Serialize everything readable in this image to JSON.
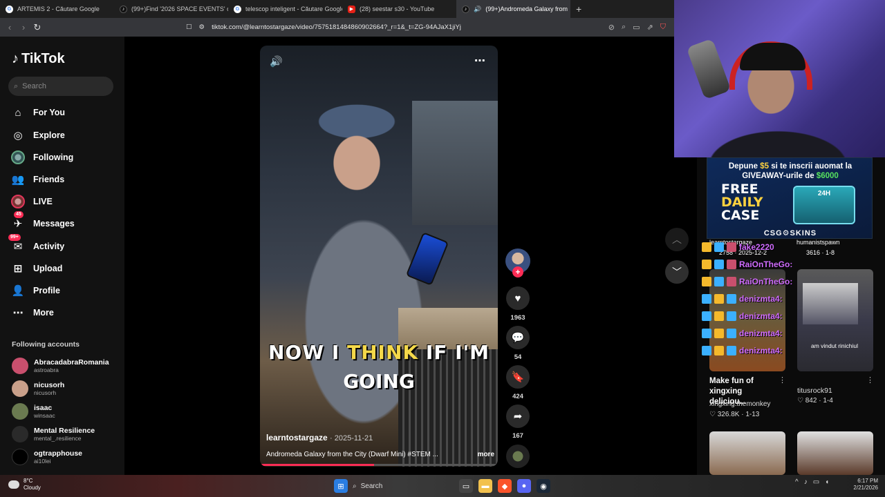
{
  "browser": {
    "tabs": [
      {
        "title": "ARTEMIS 2 - Căutare Google",
        "icon": "google"
      },
      {
        "title": "(99+)Find '2026 SPACE EVENTS' on T",
        "icon": "tiktok"
      },
      {
        "title": "telescop inteligent - Căutare Google",
        "icon": "google"
      },
      {
        "title": "(28) seestar s30 - YouTube",
        "icon": "youtube"
      },
      {
        "title": "(99+)Andromeda Galaxy from",
        "icon": "tiktok",
        "active": true
      }
    ],
    "new_tab": "+",
    "url": "tiktok.com/@learntostargaze/video/7575181484860902664?_r=1&_t=ZG-94AJaX1jiYj"
  },
  "tiktok": {
    "logo": "TikTok",
    "search_placeholder": "Search",
    "nav": {
      "for_you": "For You",
      "explore": "Explore",
      "following": "Following",
      "friends": "Friends",
      "live": "LIVE",
      "messages": "Messages",
      "messages_badge": "45",
      "activity": "Activity",
      "activity_badge": "99+",
      "upload": "Upload",
      "profile": "Profile",
      "more": "More"
    },
    "following_title": "Following accounts",
    "accounts": [
      {
        "name": "AbracadabraRomania",
        "handle": "astroabra",
        "color": "#c94f6d"
      },
      {
        "name": "nicusorh",
        "handle": "nicusorh",
        "color": "#c9a08a"
      },
      {
        "name": "isaac",
        "handle": "winsaac",
        "color": "#6a7a50"
      },
      {
        "name": "Mental Resilience",
        "handle": "mental_.resilience",
        "color": "#2a2a2a"
      },
      {
        "name": "ogtrapphouse",
        "handle": "ai10lei",
        "color": "#000000"
      }
    ]
  },
  "video": {
    "caption_line1_a": "NOW I ",
    "caption_line1_b": "THINK",
    "caption_line1_c": " IF I'M",
    "caption_line2": "GOING",
    "author": "learntostargaze",
    "date": "· 2025-11-21",
    "description": "Andromeda Galaxy from the City (Dwarf Mini) #STEM ...",
    "more": "more",
    "progress": 0.48,
    "likes": "1963",
    "comments": "54",
    "saves": "424",
    "shares": "167"
  },
  "right": {
    "ad_line1_a": "Depune ",
    "ad_line1_b": "$5",
    "ad_line1_c": " si te inscrii auomat la",
    "ad_line2_a": "GIVEAWAY-urile de ",
    "ad_line2_b": "$6000",
    "ad_free1": "FREE",
    "ad_free2": "DAILY",
    "ad_free3": "CASE",
    "ad_box": "24H",
    "ad_brand": "CSG⚙SKINS",
    "card1_author": "learntostargaze",
    "card1_meta": "2758 · 2025-12-2",
    "card2_author": "humanistspawn",
    "card2_meta": "3616 · 1-8",
    "chat": [
      "fake2220",
      "RaiOnTheGo:",
      "RaiOnTheGo:",
      "denizmta4:",
      "denizmta4:",
      "denizmta4:",
      "denizmta4:"
    ],
    "thumb2_overlay": "am vindut rinichiul",
    "card3_title": "Make fun of xingxing deliciou...",
    "card3_author": "xingxing.themonkey",
    "card3_meta": "326.8K · 1-13",
    "card4_author": "titusrock91",
    "card4_meta": "842 · 1-4"
  },
  "taskbar": {
    "temp": "8°C",
    "weather": "Cloudy",
    "search": "Search",
    "time": "6:17 PM",
    "date": "2/21/2026"
  }
}
